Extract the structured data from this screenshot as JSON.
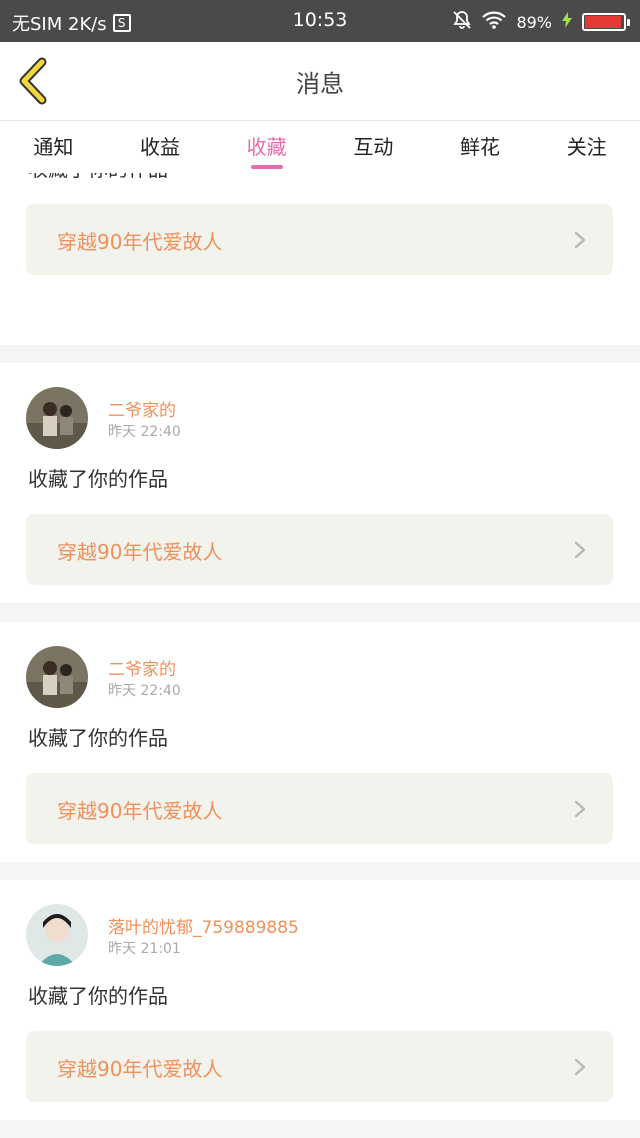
{
  "status_bar": {
    "carrier": "无SIM 2K/s",
    "sim_icon_letter": "S",
    "time": "10:53",
    "battery_percent": "89%",
    "battery_level": 0.89,
    "battery_color": "#e53935"
  },
  "header": {
    "title": "消息"
  },
  "tabs": [
    {
      "label": "通知",
      "active": false
    },
    {
      "label": "收益",
      "active": false
    },
    {
      "label": "收藏",
      "active": true
    },
    {
      "label": "互动",
      "active": false
    },
    {
      "label": "鲜花",
      "active": false
    },
    {
      "label": "关注",
      "active": false
    }
  ],
  "accent_color": "#e76cac",
  "feed": [
    {
      "username": "",
      "time": "",
      "action": "收藏了你的作品",
      "work_title": "穿越90年代爱故人"
    },
    {
      "username": "二爷家的",
      "time": "昨天 22:40",
      "action": "收藏了你的作品",
      "work_title": "穿越90年代爱故人"
    },
    {
      "username": "二爷家的",
      "time": "昨天 22:40",
      "action": "收藏了你的作品",
      "work_title": "穿越90年代爱故人"
    },
    {
      "username": "落叶的忧郁_759889885",
      "time": "昨天 21:01",
      "action": "收藏了你的作品",
      "work_title": "穿越90年代爱故人"
    }
  ]
}
